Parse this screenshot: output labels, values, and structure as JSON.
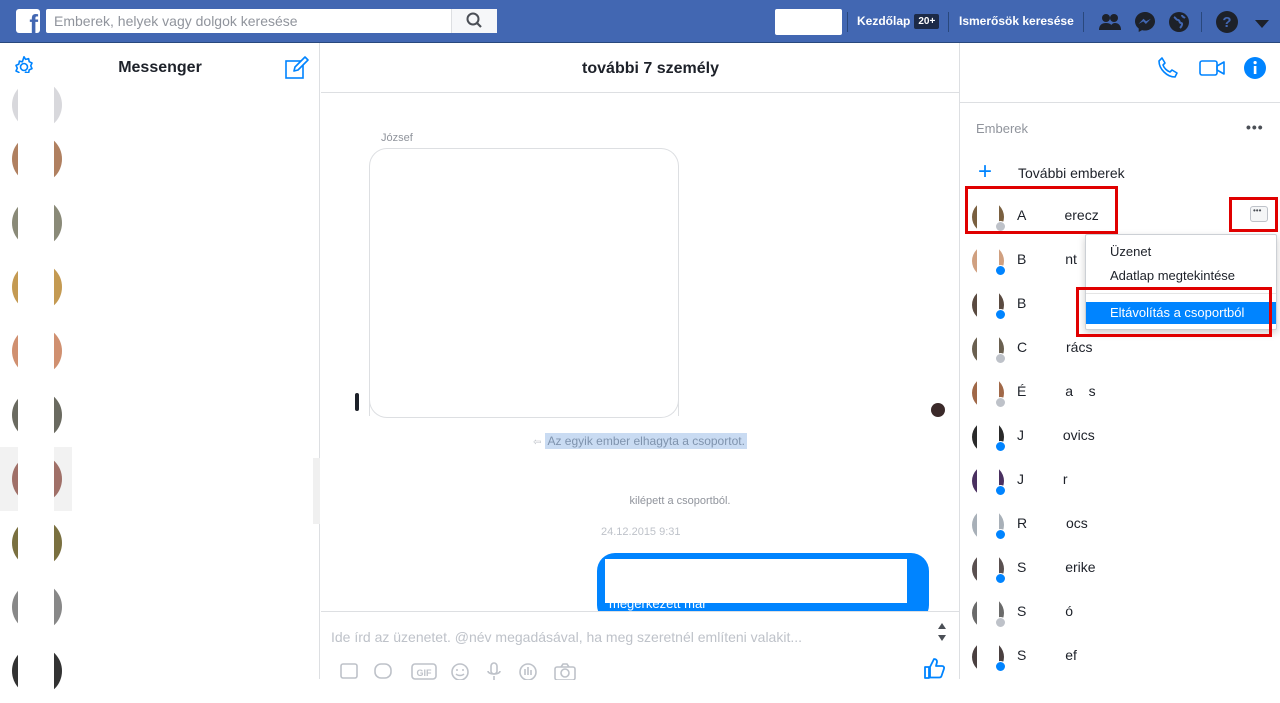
{
  "topbar": {
    "search_placeholder": "Emberek, helyek vagy dolgok keresése",
    "home_label": "Kezdőlap",
    "home_badge": "20+",
    "find_friends_label": "Ismerősök keresése",
    "icons": [
      "friend-requests-icon",
      "messenger-icon",
      "notifications-globe-icon",
      "help-icon",
      "account-menu-icon"
    ]
  },
  "left": {
    "title": "Messenger",
    "settings_icon": "gear-icon",
    "compose_icon": "compose-icon"
  },
  "conversation": {
    "title": "további 7 személy",
    "sender_name": "József",
    "system_left_notice": "Az egyik ember elhagyta a csoportot.",
    "system_left_notice2": "kilépett a csoportból.",
    "timestamp": "24.12.2015 9:31",
    "my_message_partial": "megérkezett már",
    "composer_placeholder": "Ide írd az üzenetet. @név megadásával, ha meg szeretnél említeni valakit..."
  },
  "right": {
    "people_title": "Emberek",
    "more_dots": "•••",
    "add_people_label": "További emberek",
    "people": [
      {
        "name": "A          erecz",
        "badge": "grey"
      },
      {
        "name": "B          nt",
        "badge": "blue"
      },
      {
        "name": "B",
        "badge": "blue"
      },
      {
        "name": "C          rács",
        "badge": "grey"
      },
      {
        "name": "É          a    s",
        "badge": "grey"
      },
      {
        "name": "J          ovics",
        "badge": "blue"
      },
      {
        "name": "J          r",
        "badge": "blue"
      },
      {
        "name": "R          ocs",
        "badge": "blue"
      },
      {
        "name": "S          erike",
        "badge": "blue"
      },
      {
        "name": "S          ó",
        "badge": "grey"
      },
      {
        "name": "S          ef",
        "badge": "blue"
      }
    ]
  },
  "menu": {
    "items": [
      "Üzenet",
      "Adatlap megtekintése",
      "Eltávolítás a csoportból"
    ],
    "selected": "Eltávolítás a csoportból"
  },
  "colors": {
    "brand": "#4267b2",
    "messenger_blue": "#0084ff",
    "highlight_red": "#e00000"
  }
}
